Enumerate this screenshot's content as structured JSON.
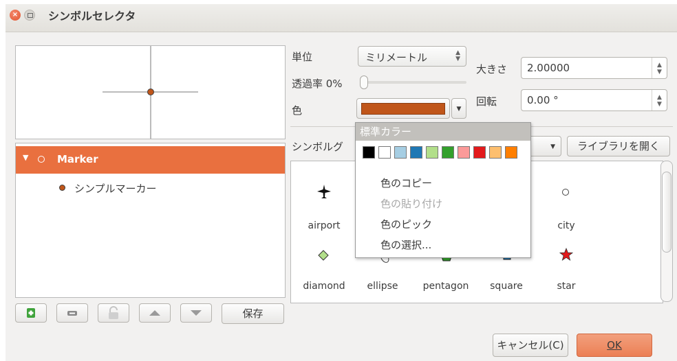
{
  "window": {
    "title": "シンボルセレクタ"
  },
  "layer_tree": {
    "root_label": "Marker",
    "child_label": "シンプルマーカー"
  },
  "toolbar": {
    "save_label": "保存"
  },
  "properties": {
    "unit_label": "単位",
    "unit_value": "ミリメートル",
    "opacity_label": "透過率 0%",
    "opacity_value": 0,
    "color_label": "色",
    "color_value": "#c0561a",
    "size_label": "大きさ",
    "size_value": "2.00000",
    "rotation_label": "回転",
    "rotation_value": "0.00 °"
  },
  "symbol_group": {
    "label": "シンボルグ",
    "open_library_label": "ライブラリを開く"
  },
  "symbols": [
    {
      "name": "airport",
      "icon": "airplane-icon"
    },
    {
      "name": "city",
      "icon": "circle-icon"
    },
    {
      "name": "diamond",
      "icon": "diamond-icon"
    },
    {
      "name": "ellipse",
      "icon": "ellipse-icon"
    },
    {
      "name": "pentagon",
      "icon": "pentagon-icon"
    },
    {
      "name": "square",
      "icon": "square-icon"
    },
    {
      "name": "star",
      "icon": "star-icon"
    }
  ],
  "color_popup": {
    "header": "標準カラー",
    "swatches": [
      "#000000",
      "#ffffff",
      "#a6cee3",
      "#1f78b4",
      "#b2df8a",
      "#33a02c",
      "#fb9a99",
      "#e31a1c",
      "#fdbf6f",
      "#ff7f00"
    ],
    "items": [
      "色のコピー",
      "色の貼り付け",
      "色のピック",
      "色の選択..."
    ]
  },
  "buttons": {
    "cancel_label": "キャンセル(C)",
    "ok_label": "OK"
  },
  "colors": {
    "accent": "#e9703f",
    "marker": "#c0561a"
  }
}
